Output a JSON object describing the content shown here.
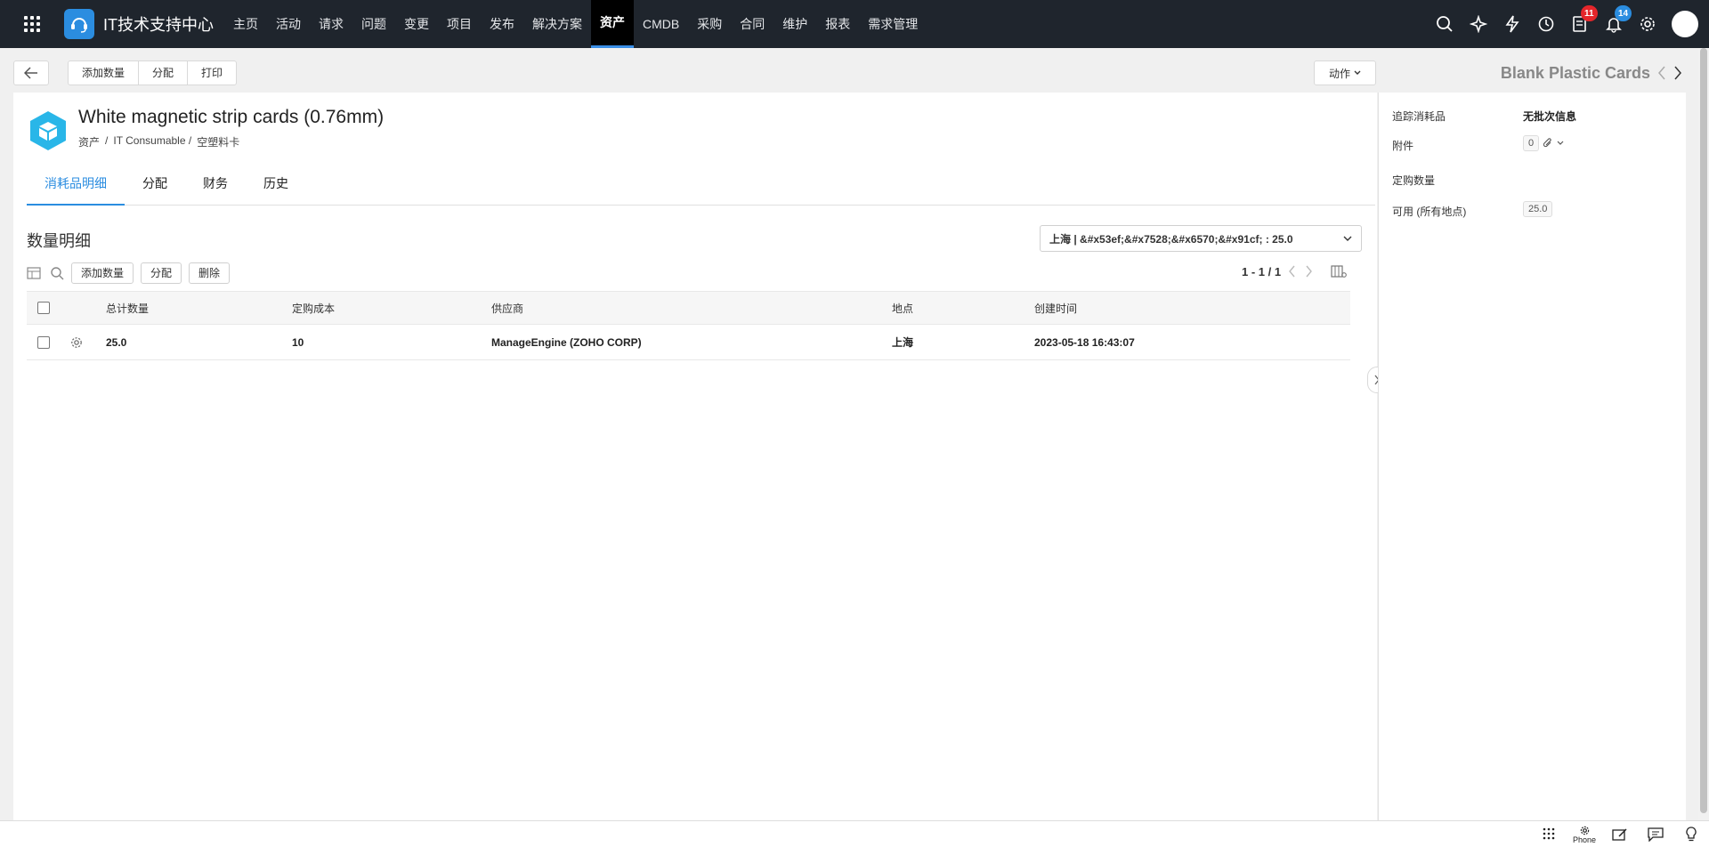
{
  "app": {
    "title": "IT技术支持中心"
  },
  "nav": {
    "items": [
      "主页",
      "活动",
      "请求",
      "问题",
      "变更",
      "项目",
      "发布",
      "解决方案",
      "资产",
      "CMDB",
      "采购",
      "合同",
      "维护",
      "报表",
      "需求管理"
    ],
    "active": "资产"
  },
  "badges": {
    "tasks": "11",
    "notifications": "14"
  },
  "toolbar": {
    "add_qty": "添加数量",
    "assign": "分配",
    "print": "打印",
    "actions": "动作"
  },
  "record_nav": {
    "name": "Blank Plastic Cards"
  },
  "item": {
    "title": "White magnetic strip cards (0.76mm)",
    "breadcrumb": [
      "资产",
      "/",
      "IT Consumable /",
      "空塑料卡"
    ]
  },
  "tabs": [
    "消耗品明细",
    "分配",
    "财务",
    "历史"
  ],
  "qty_section": {
    "title": "数量明细",
    "location_select": "上海 | &#x53ef;&#x7528;&#x6570;&#x91cf; : 25.0",
    "buttons": {
      "add_qty": "添加数量",
      "assign": "分配",
      "delete": "删除"
    },
    "pager": "1 - 1 / 1",
    "columns": [
      "总计数量",
      "定购成本",
      "供应商",
      "地点",
      "创建时间"
    ],
    "rows": [
      {
        "total": "25.0",
        "cost": "10",
        "vendor": "ManageEngine (ZOHO CORP)",
        "location": "上海",
        "created": "2023-05-18 16:43:07"
      }
    ]
  },
  "side": {
    "track_label": "追踪消耗品",
    "track_value": "无批次信息",
    "attach_label": "附件",
    "attach_count": "0",
    "ordered_label": "定购数量",
    "available_label": "可用 (所有地点)",
    "available_value": "25.0"
  },
  "footer": {
    "phone": "Phone"
  },
  "colors": {
    "nav_bg": "#1f252d",
    "accent": "#2b8de0",
    "badge_red": "#e5262b",
    "cube": "#29b6e8"
  }
}
